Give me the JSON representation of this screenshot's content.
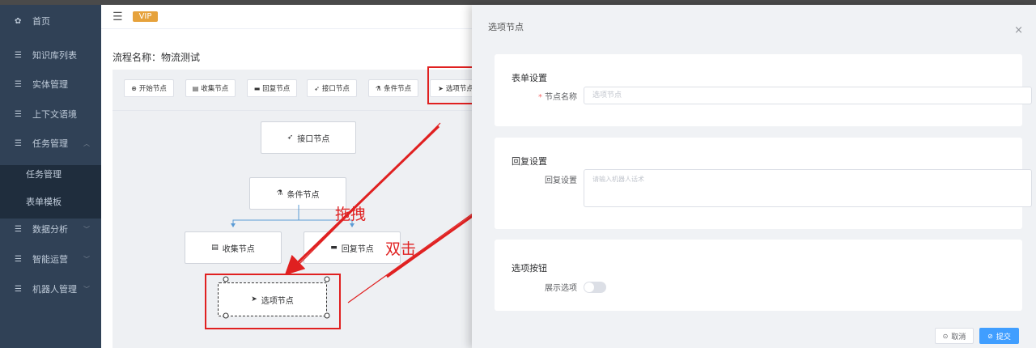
{
  "sidebar": {
    "items": [
      {
        "icon": "dashboard-icon",
        "glyph": "✿",
        "label": "首页"
      },
      {
        "icon": "list-icon",
        "glyph": "☰",
        "label": "知识库列表"
      },
      {
        "icon": "list-icon",
        "glyph": "☰",
        "label": "实体管理"
      },
      {
        "icon": "list-icon",
        "glyph": "☰",
        "label": "上下文语境"
      },
      {
        "icon": "list-icon",
        "glyph": "☰",
        "label": "任务管理",
        "expanded": true
      },
      {
        "icon": "list-icon",
        "glyph": "☰",
        "label": "数据分析"
      },
      {
        "icon": "list-icon",
        "glyph": "☰",
        "label": "智能运营"
      },
      {
        "icon": "list-icon",
        "glyph": "☰",
        "label": "机器人管理"
      }
    ],
    "subitems": [
      {
        "label": "任务管理"
      },
      {
        "label": "表单模板"
      }
    ]
  },
  "navbar": {
    "vip": "VIP"
  },
  "flow": {
    "title": "流程名称：物流测试"
  },
  "toolbar": {
    "buttons": [
      {
        "glyph": "⊕",
        "label": "开始节点"
      },
      {
        "glyph": "▤",
        "label": "收集节点"
      },
      {
        "glyph": "▬",
        "label": "回复节点"
      },
      {
        "glyph": "➶",
        "label": "接口节点"
      },
      {
        "glyph": "⚗",
        "label": "条件节点"
      },
      {
        "glyph": "➤",
        "label": "选项节点"
      }
    ]
  },
  "nodes": {
    "api": {
      "glyph": "➶",
      "label": "接口节点"
    },
    "condition": {
      "glyph": "⚗",
      "label": "条件节点"
    },
    "collect": {
      "glyph": "▤",
      "label": "收集节点"
    },
    "reply": {
      "glyph": "▬",
      "label": "回复节点"
    },
    "option": {
      "glyph": "➤",
      "label": "选项节点"
    }
  },
  "annotations": {
    "drag": "拖拽",
    "dblclick": "双击"
  },
  "drawer": {
    "title": "选项节点",
    "close_glyph": "×",
    "form_card": {
      "title": "表单设置",
      "name_label": "节点名称",
      "name_placeholder": "选项节点"
    },
    "reply_card": {
      "title": "回复设置",
      "reply_label": "回复设置",
      "reply_placeholder": "请输入机器人话术"
    },
    "option_card": {
      "title": "选项按钮",
      "show_label": "展示选项",
      "show_enabled": false
    },
    "footer": {
      "cancel_glyph": "⊙",
      "cancel_label": "取消",
      "submit_glyph": "⊘",
      "submit_label": "提交"
    }
  },
  "colors": {
    "sidebar": "#304156",
    "accent": "#409eff",
    "vip": "#e6a23c",
    "annotation": "#e02020"
  }
}
